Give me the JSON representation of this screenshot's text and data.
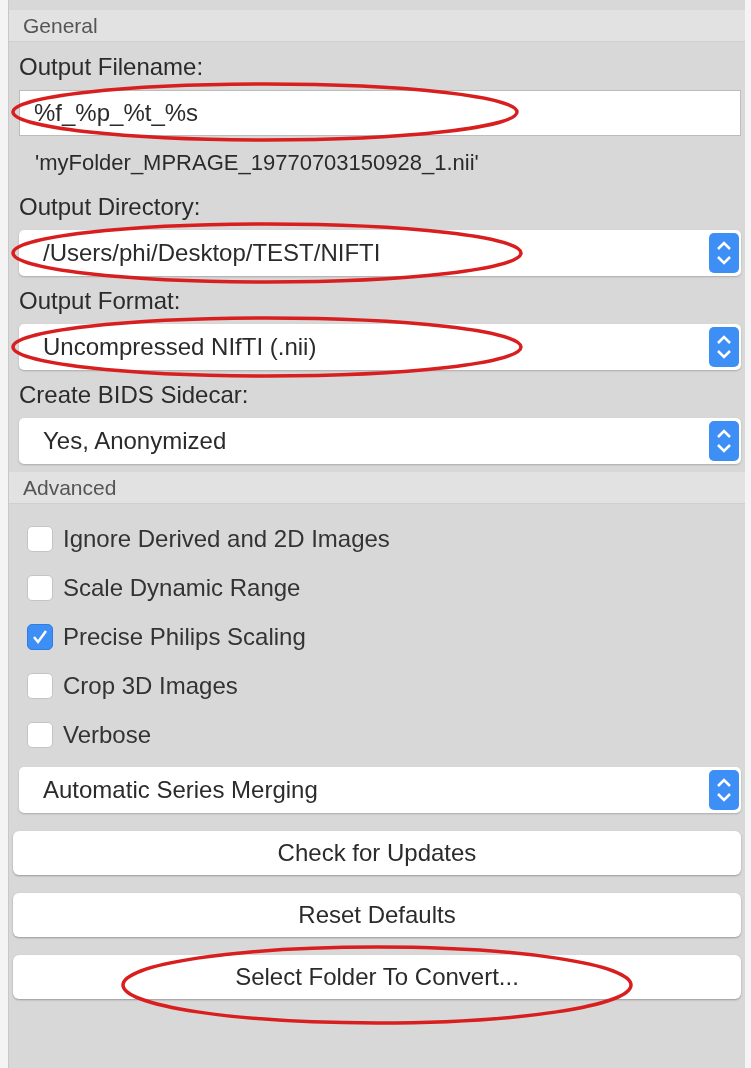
{
  "sections": [
    {
      "title": "General",
      "items": [
        {
          "kind": "text_field",
          "label": "Output Filename:",
          "value": "%f_%p_%t_%s",
          "circled": true
        },
        {
          "kind": "note",
          "text": "'myFolder_MPRAGE_19770703150928_1.nii'"
        },
        {
          "kind": "select",
          "label": "Output Directory:",
          "value": "/Users/phi/Desktop/TEST/NIFTI",
          "circled": true
        },
        {
          "kind": "select",
          "label": "Output Format:",
          "value": "Uncompressed NIfTI (.nii)",
          "circled": true
        },
        {
          "kind": "select",
          "label": "Create BIDS Sidecar:",
          "value": "Yes, Anonymized",
          "circled": false
        }
      ]
    },
    {
      "title": "Advanced",
      "items": [
        {
          "kind": "checkbox",
          "label": "Ignore Derived and 2D Images",
          "checked": false
        },
        {
          "kind": "checkbox",
          "label": "Scale Dynamic Range",
          "checked": false
        },
        {
          "kind": "checkbox",
          "label": "Precise Philips Scaling",
          "checked": true
        },
        {
          "kind": "checkbox",
          "label": "Crop 3D Images",
          "checked": false
        },
        {
          "kind": "checkbox",
          "label": "Verbose",
          "checked": false
        },
        {
          "kind": "select",
          "value": "Automatic Series Merging",
          "circled": false
        },
        {
          "kind": "button",
          "label": "Check for Updates",
          "circled": false
        },
        {
          "kind": "button",
          "label": "Reset Defaults",
          "circled": false
        },
        {
          "kind": "button",
          "label": "Select Folder To Convert...",
          "circled": true
        }
      ]
    }
  ]
}
